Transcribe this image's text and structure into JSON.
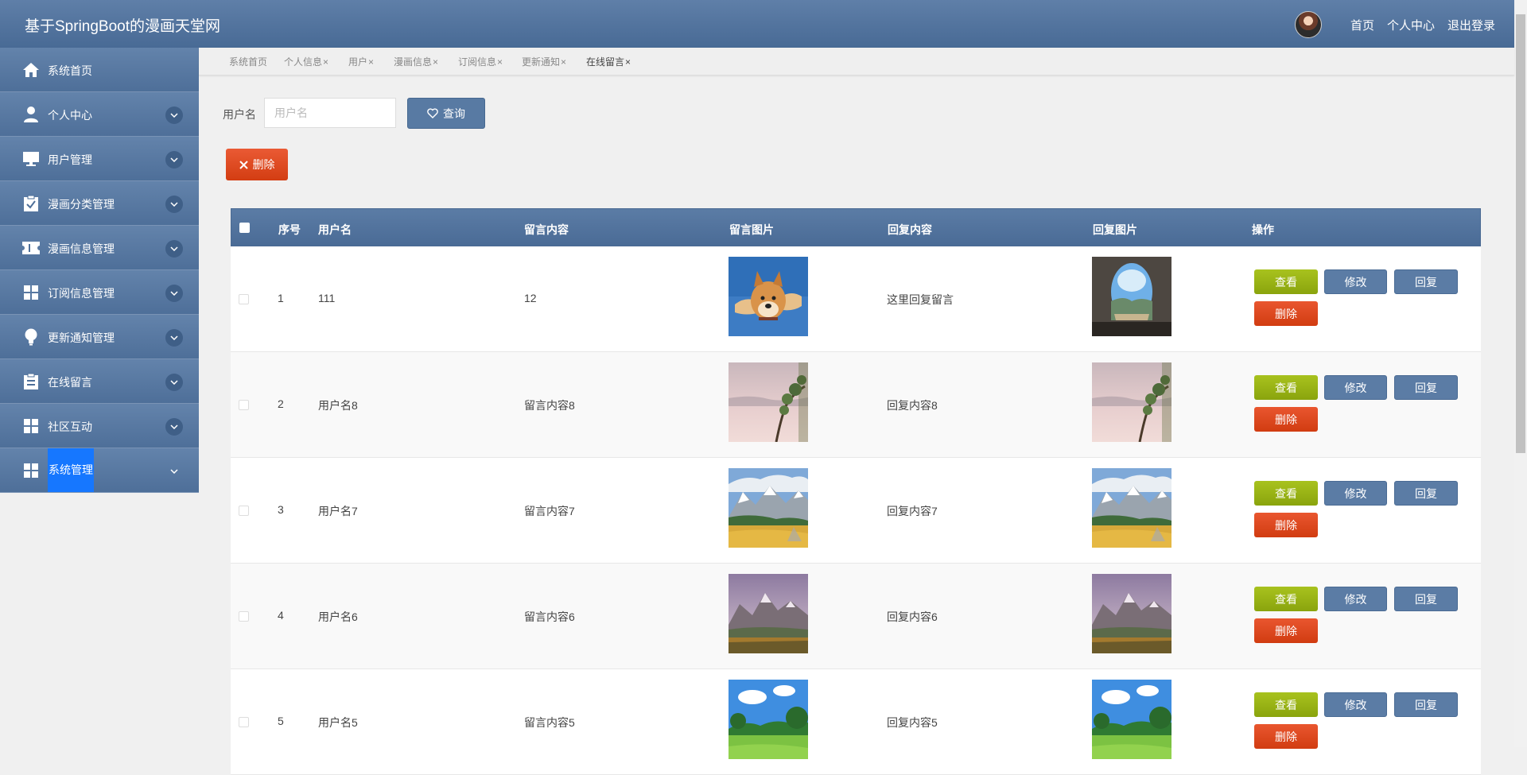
{
  "app": {
    "title": "基于SpringBoot的漫画天堂网",
    "nav": {
      "home": "首页",
      "profile": "个人中心",
      "logout": "退出登录"
    }
  },
  "sidebar": {
    "items": [
      {
        "label": "系统首页",
        "icon": "home-icon",
        "has_chevron": false
      },
      {
        "label": "个人中心",
        "icon": "user-icon",
        "has_chevron": true
      },
      {
        "label": "用户管理",
        "icon": "monitor-icon",
        "has_chevron": true
      },
      {
        "label": "漫画分类管理",
        "icon": "clipboard-check-icon",
        "has_chevron": true
      },
      {
        "label": "漫画信息管理",
        "icon": "ticket-icon",
        "has_chevron": true
      },
      {
        "label": "订阅信息管理",
        "icon": "grid-icon",
        "has_chevron": true
      },
      {
        "label": "更新通知管理",
        "icon": "bulb-icon",
        "has_chevron": true
      },
      {
        "label": "在线留言",
        "icon": "clipboard-icon",
        "has_chevron": true
      },
      {
        "label": "社区互动",
        "icon": "grid-icon",
        "has_chevron": true
      },
      {
        "label": "系统管理",
        "icon": "grid-icon",
        "has_chevron": true,
        "active": true
      }
    ]
  },
  "tabs": [
    {
      "label": "系统首页",
      "closable": false
    },
    {
      "label": "个人信息",
      "closable": true
    },
    {
      "label": "用户",
      "closable": true
    },
    {
      "label": "漫画信息",
      "closable": true
    },
    {
      "label": "订阅信息",
      "closable": true
    },
    {
      "label": "更新通知",
      "closable": true
    },
    {
      "label": "在线留言",
      "closable": true,
      "current": true
    }
  ],
  "tab_close_glyph": "×",
  "search": {
    "label": "用户名",
    "placeholder": "用户名",
    "value": "",
    "button": "查询"
  },
  "toolbar": {
    "delete": "删除"
  },
  "table": {
    "headers": {
      "index": "序号",
      "username": "用户名",
      "content": "留言内容",
      "image": "留言图片",
      "reply": "回复内容",
      "reply_image": "回复图片",
      "actions": "操作"
    },
    "action_labels": {
      "view": "查看",
      "edit": "修改",
      "reply": "回复",
      "delete": "删除"
    },
    "rows": [
      {
        "index": "1",
        "username": "111",
        "content": "12",
        "reply": "这里回复留言",
        "image": "dog",
        "reply_image": "cave-window"
      },
      {
        "index": "2",
        "username": "用户名8",
        "content": "留言内容8",
        "reply": "回复内容8",
        "image": "misty-pine",
        "reply_image": "misty-pine"
      },
      {
        "index": "3",
        "username": "用户名7",
        "content": "留言内容7",
        "reply": "回复内容7",
        "image": "snow-mountain-autumn",
        "reply_image": "snow-mountain-autumn"
      },
      {
        "index": "4",
        "username": "用户名6",
        "content": "留言内容6",
        "reply": "回复内容6",
        "image": "purple-mountains",
        "reply_image": "purple-mountains"
      },
      {
        "index": "5",
        "username": "用户名5",
        "content": "留言内容5",
        "reply": "回复内容5",
        "image": "green-meadow",
        "reply_image": "green-meadow"
      }
    ]
  },
  "colors": {
    "primary": "#587aa3",
    "danger": "#d9441a",
    "success": "#9ab515",
    "active_highlight": "#1677ff"
  }
}
